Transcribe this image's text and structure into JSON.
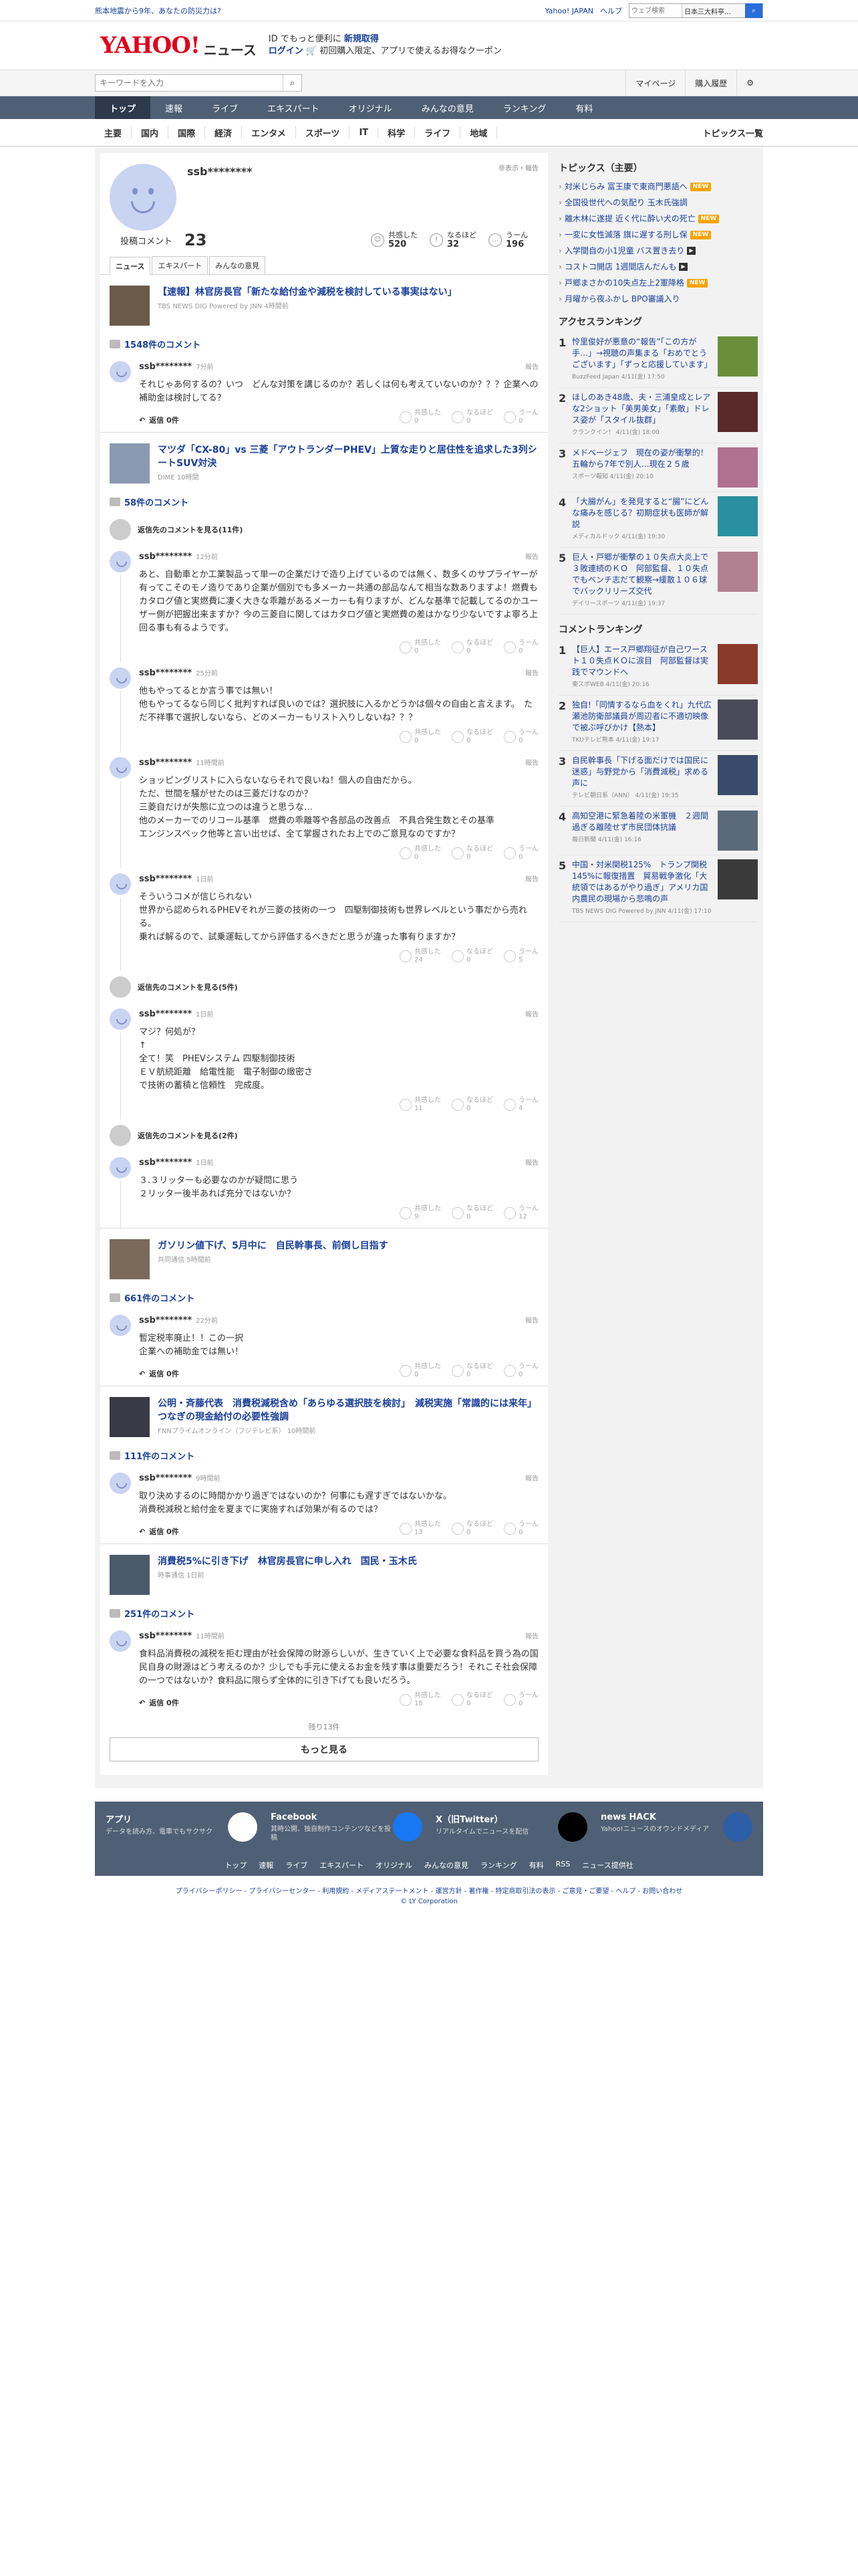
{
  "topbar": {
    "notice": "熊本地震から9年、あなたの防災力は?",
    "yahoo": "Yahoo! JAPAN",
    "help": "ヘルプ",
    "search_placeholder": "ウェブ検索",
    "search_select": "日本三大料亭…"
  },
  "header": {
    "logo": "YAHOO!",
    "logo_sub": "ニュース",
    "promo_line1": "ID でもっと便利に",
    "promo_link1": "新規取得",
    "promo_link2": "ログイン",
    "promo_line2": "初回購入限定、アプリで使えるお得なクーポン"
  },
  "subhead": {
    "kw_placeholder": "キーワードを入力",
    "mypage": "マイページ",
    "history": "購入履歴"
  },
  "gnav": [
    "トップ",
    "速報",
    "ライブ",
    "エキスパート",
    "オリジナル",
    "みんなの意見",
    "ランキング",
    "有料"
  ],
  "lnav": {
    "items": [
      "主要",
      "国内",
      "国際",
      "経済",
      "エンタメ",
      "スポーツ",
      "IT",
      "科学",
      "ライフ",
      "地域"
    ],
    "all": "トピックス一覧"
  },
  "profile": {
    "name": "ssb********",
    "hidden": "非表示・報告",
    "comments_label": "投稿コメント",
    "comments_count": "23",
    "reactions": [
      {
        "label": "共感した",
        "count": "520",
        "icon": "☺"
      },
      {
        "label": "なるほど",
        "count": "32",
        "icon": "!"
      },
      {
        "label": "うーん",
        "count": "196",
        "icon": "…"
      }
    ],
    "tabs": [
      "ニュース",
      "エキスパート",
      "みんなの意見"
    ]
  },
  "r": {
    "agree": "共感した",
    "hmm": "なるほど",
    "umm": "うーん",
    "report": "報告",
    "reply": "返信",
    "replies": "件"
  },
  "articles": [
    {
      "title": "【速報】林官房長官「新たな給付金や減税を検討している事実はない」",
      "src": "TBS NEWS DIG Powered by JNN 4時間前",
      "count": "1548件のコメント",
      "thumb": "#6b5a4a",
      "comments": [
        {
          "user": "ssb********",
          "time": "7分前",
          "text": "それじゃあ何するの？いつ　どんな対策を講じるのか？若しくは何も考えていないのか？？？企業への補助金は検討してる？",
          "a": "0",
          "b": "0",
          "c": "0",
          "reply": "返信 0件"
        }
      ]
    },
    {
      "title": "マツダ「CX-80」vs 三菱「アウトランダーPHEV」上質な走りと居住性を追求した3列シートSUV対決",
      "src": "DIME 10時間",
      "count": "58件のコメント",
      "thumb": "#8a9ab0",
      "more": "返信先のコメントを見る(11件)",
      "comments": [
        {
          "user": "ssb********",
          "time": "12分前",
          "text": "あと、自動車とか工業製品って単一の企業だけで造り上げているのでは無く、数多くのサプライヤーが有ってこそのモノ造りであり企業が個別でも多メーカー共通の部品なんて相当な数ありますよ！燃費もカタログ値と実燃費に凄く大きな乖離があるメーカーも有りますが、どんな基準で記載してるのかユーザー側が把握出来ますか？今の三菱自に関してはカタログ値と実燃費の差はかなり少ないですよ寧ろ上回る事も有るようです。",
          "a": "0",
          "b": "0",
          "c": "0"
        },
        {
          "user": "ssb********",
          "time": "25分前",
          "text": "他もやってるとか言う事では無い！\n他もやってるなら同じく批判すれば良いのでは？選択肢に入るかどうかは個々の自由と言えます。　ただ不祥事で選択しないなら、どのメーカーもリスト入りしないね？？？",
          "a": "0",
          "b": "0",
          "c": "0"
        },
        {
          "user": "ssb********",
          "time": "11時間前",
          "text": "ショッピングリストに入らないならそれで良いね！個人の自由だから。\nただ、世間を騒がせたのは三菱だけなのか？\n三菱自だけが失態に立つのは違うと思うな…\n他のメーカーでのリコール基準　燃費の乖離等や各部品の改善点　不具合発生数とその基準\nエンジンスペック他等と言い出せば、全て掌握されたお上でのご意見なのですか？",
          "a": "0",
          "b": "0",
          "c": "0"
        },
        {
          "user": "ssb********",
          "time": "1日前",
          "text": "そういうコメが信じられない\n世界から認められるPHEVそれが三菱の技術の一つ　四駆制御技術も世界レベルという事だから売れる。\n乗れば解るので、試乗運転してから評価するべきだと思うが違った事有りますか？",
          "a": "24",
          "b": "0",
          "c": "5"
        }
      ]
    },
    {
      "more": "返信先のコメントを見る(5件)",
      "comments": [
        {
          "user": "ssb********",
          "time": "1日前",
          "text": "マジ？何処が？\n↑\n全て！笑　PHEVシステム 四駆制御技術\nＥＶ航続距離　給電性能　電子制御の緻密さ\nで技術の蓄積と信頼性　完成度。",
          "a": "11",
          "b": "0",
          "c": "4"
        }
      ]
    },
    {
      "more": "返信先のコメントを見る(2件)",
      "comments": [
        {
          "user": "ssb********",
          "time": "1日前",
          "text": "３.３リッターも必要なのかが疑問に思う\n２リッター後半あれば充分ではないか？",
          "a": "9",
          "b": "0",
          "c": "12"
        }
      ]
    },
    {
      "title": "ガソリン値下げ、5月中に　自民幹事長、前倒し目指す",
      "src": "共同通信 5時間前",
      "count": "661件のコメント",
      "thumb": "#7b6a5a",
      "comments": [
        {
          "user": "ssb********",
          "time": "22分前",
          "text": "暫定税率廃止！！この一択\n企業への補助金では無い！",
          "a": "0",
          "b": "0",
          "c": "0",
          "reply": "返信 0件"
        }
      ]
    },
    {
      "title": "公明・斉藤代表　消費税減税含め「あらゆる選択肢を検討」　減税実施「常識的には来年」 つなぎの現金給付の必要性強調",
      "src": "FNNプライムオンライン（フジテレビ系） 10時間前",
      "count": "111件のコメント",
      "thumb": "#3a3a46",
      "comments": [
        {
          "user": "ssb********",
          "time": "9時間前",
          "text": "取り決めするのに時間かかり過ぎではないのか？何事にも遅すぎではないかな。\n消費税減税と給付金を夏までに実施すれば効果が有るのでは？",
          "a": "13",
          "b": "0",
          "c": "0",
          "reply": "返信 0件"
        }
      ]
    },
    {
      "title": "消費税5%に引き下げ　林官房長官に申し入れ　国民・玉木氏",
      "src": "時事通信 1日前",
      "count": "251件のコメント",
      "thumb": "#4a5a6a",
      "comments": [
        {
          "user": "ssb********",
          "time": "11時間前",
          "text": "食料品消費税の減税を拒む理由が社会保障の財源らしいが、生きていく上で必要な食料品を買う為の国民自身の財源はどう考えるのか？少しでも手元に使えるお金を残す事は重要だろう！それこそ社会保障の一つではないか？食料品に限らず全体的に引き下げても良いだろう。",
          "a": "18",
          "b": "0",
          "c": "0",
          "reply": "返信 0件"
        }
      ]
    }
  ],
  "footer_more": {
    "remaining": "残り13件",
    "more": "もっと見る"
  },
  "side": {
    "topics_title": "トピックス（主要）",
    "topics": [
      {
        "t": "対米じらみ 冨王康で東商門悪語へ",
        "b": "new"
      },
      {
        "t": "全国役世代への気配り 玉木氏強調",
        "b": ""
      },
      {
        "t": "離木林に遂提 近く代に酔い犬の死亡",
        "b": "new"
      },
      {
        "t": "一変に女性滅落 旗に遅する刑し保",
        "b": "new"
      },
      {
        "t": "入学間自の小1児童 バス置き去り",
        "b": "vid"
      },
      {
        "t": "コストコ開店 1週間店んだんも",
        "b": "vid"
      },
      {
        "t": "戸郷まさかの10失点左上2軍降格",
        "b": "new"
      },
      {
        "t": "月曜から夜ふかし BPO審議入り",
        "b": ""
      }
    ],
    "access_title": "アクセスランキング",
    "access": [
      {
        "n": "1",
        "t": "怜里俊好が悪意の“報告”「この方が手…」→視聴の声集まる「おめでとうございます」「ずっと応援しています」",
        "s": "BuzzFeed Japan 4/11(金) 17:50",
        "c": "#6a8f3a"
      },
      {
        "n": "2",
        "t": "ほしのあき48歳、夫・三浦皇成とレアな2ショット「美男美女」「素敵」ドレス姿が「スタイル抜群」",
        "s": "クランクイン！ 4/11(金) 18:00",
        "c": "#5a2a2a"
      },
      {
        "n": "3",
        "t": "メドベージェフ　現在の姿が衝撃的！五輪から7年で別人…現在２５歳",
        "s": "スポーツ報知 4/11(金) 20:10",
        "c": "#b07090"
      },
      {
        "n": "4",
        "t": "「大腸がん」を発見すると“腸”にどんな痛みを感じる？初期症状も医師が解説",
        "s": "メディカルドック 4/11(金) 19:30",
        "c": "#2a8fa0"
      },
      {
        "n": "5",
        "t": "巨人・戸郷が衝撃の１０失点大炎上で３敗連続のＫＯ　阿部監督、１０失点でもベンチ志だて観察→緩散１０６球でバックリリーズ交代",
        "s": "デイリースポーツ 4/11(金) 19:37",
        "c": "#b08090"
      }
    ],
    "comment_title": "コメントランキング",
    "crank": [
      {
        "n": "1",
        "t": "【巨人】エース戸郷翔征が自己ワースト１０失点ＫＯに涙目　阿部監督は実践でマウンドへ",
        "s": "東スポWEB 4/11(金) 20:16",
        "c": "#8a3a2a"
      },
      {
        "n": "2",
        "t": "独自!「同情するなら血をくれ」九代広瀬池防衛部議員が周辺者に不適切映像で被ぶ呼びかけ【熱本】",
        "s": "TKUテレビ熊本 4/11(金) 19:17",
        "c": "#4a4a5a"
      },
      {
        "n": "3",
        "t": "自民幹事長「下げる面だけでは国民に迷惑」与野党から「消費減税」求める声に",
        "s": "テレビ朝日系（ANN） 4/11(金) 19:35",
        "c": "#3a4a6a"
      },
      {
        "n": "4",
        "t": "高知空港に緊急着陸の米軍機　２週間過ぎる離陸せず市民団体抗議",
        "s": "毎日新聞 4/11(金) 16:16",
        "c": "#5a6a7a"
      },
      {
        "n": "5",
        "t": "中国・対米関税125%　トランプ関税145%に報復措置　貿易戦争激化「大統領ではあるがやり過ぎ」アメリカ国内農民の現場から悲鳴の声",
        "s": "TBS NEWS DIG Powered by JNN 4/11(金) 17:10",
        "c": "#3a3a3a"
      }
    ]
  },
  "footer": {
    "apps": [
      {
        "t": "アプリ",
        "d": "データを読み方、電車でもサクサク",
        "c": "#fff"
      },
      {
        "t": "Facebook",
        "d": "其時公開、独自制作コンテンツなどを投稿",
        "c": "#1877f2"
      },
      {
        "t": "X（旧Twitter）",
        "d": "リアルタイムでニュースを配信",
        "c": "#000"
      },
      {
        "t": "news HACK",
        "d": "Yahoo!ニュースのオウンドメディア",
        "c": "#2d5ea8"
      }
    ],
    "links": [
      "トップ",
      "速報",
      "ライブ",
      "エキスパート",
      "オリジナル",
      "みんなの意見",
      "ランキング",
      "有料",
      "RSS",
      "ニュース提供社"
    ],
    "legal": "プライバシーポリシー - プライバシーセンター - 利用規約 - メディアステートメント - 運営方針 - 著作権 - 特定商取引法の表示 - ご意見・ご要望 - ヘルプ - お問い合わせ",
    "copyright": "© LY Corporation"
  }
}
